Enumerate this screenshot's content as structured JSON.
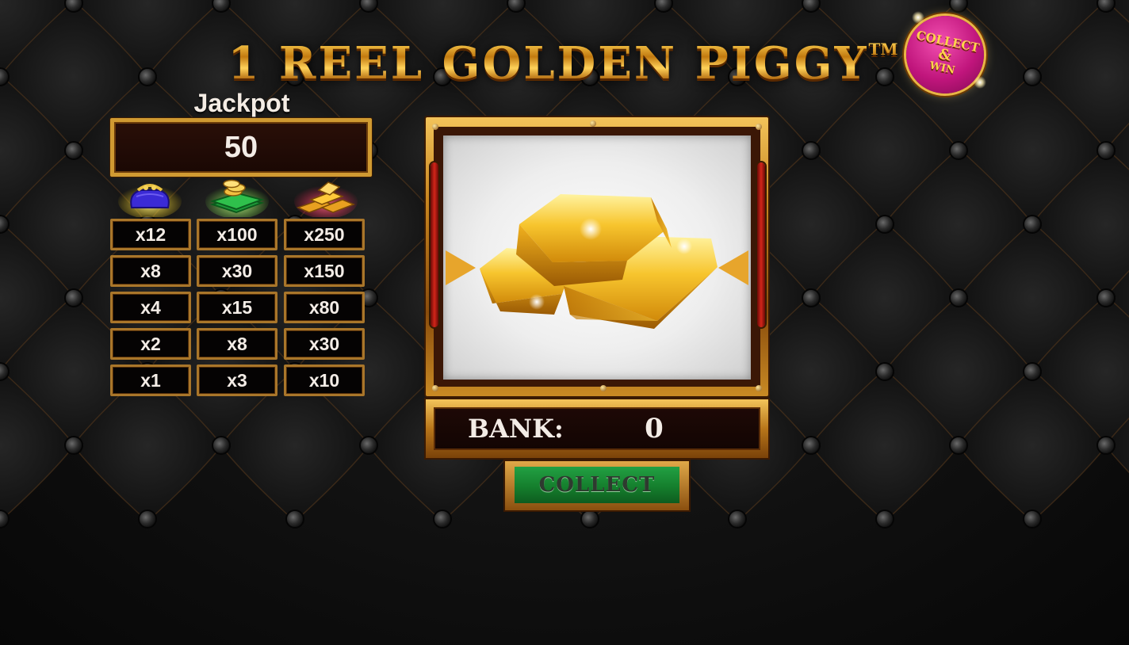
{
  "game": {
    "title": "1 REEL GOLDEN PIGGY",
    "trademark": "TM",
    "badge": {
      "line1": "COLLECT",
      "line2": "&",
      "line3": "WIN"
    }
  },
  "jackpot": {
    "label": "Jackpot",
    "value": "50"
  },
  "paytable": {
    "symbols": [
      "purse-icon",
      "money-stack-icon",
      "gold-bars-icon"
    ],
    "rows": [
      [
        "x12",
        "x100",
        "x250"
      ],
      [
        "x8",
        "x30",
        "x150"
      ],
      [
        "x4",
        "x15",
        "x80"
      ],
      [
        "x2",
        "x8",
        "x30"
      ],
      [
        "x1",
        "x3",
        "x10"
      ]
    ]
  },
  "reel": {
    "symbol": "gold-bars-icon"
  },
  "bank": {
    "label": "BANK:",
    "value": "0"
  },
  "buttons": {
    "collect_label": "COLLECT"
  },
  "colors": {
    "gold": "#d09a32",
    "button_green": "#157f2d",
    "badge_pink": "#c0157c"
  }
}
